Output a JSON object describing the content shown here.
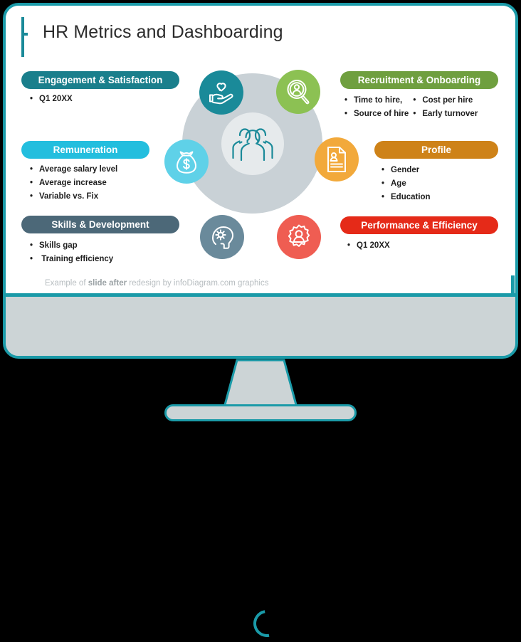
{
  "slide": {
    "title": "HR Metrics and Dashboarding",
    "footer_prefix": "Example of ",
    "footer_bold": "slide after",
    "footer_suffix": " redesign by infoDiagram.com graphics"
  },
  "colors": {
    "teal_dark": "#1a8a99",
    "teal_frame": "#1a9aa8",
    "cyan": "#23bede",
    "cyan_light": "#5fd1e8",
    "green": "#8cc153",
    "green_dark": "#6f9f3f",
    "orange": "#f2a93b",
    "orange_dark": "#ce8218",
    "red": "#e52a18",
    "red_light": "#ef5d52",
    "slate": "#4c6878",
    "slate_light": "#6a8a9b",
    "ring_gray": "#c9d1d6",
    "inner_gray": "#e6eaec",
    "bezel_gray": "#ccd4d6"
  },
  "sections": {
    "engagement": {
      "label": "Engagement & Satisfaction",
      "bullets": [
        "Q1 20XX"
      ]
    },
    "remuneration": {
      "label": "Remuneration",
      "bullets": [
        "Average salary level",
        "Average increase",
        "Variable vs. Fix"
      ]
    },
    "skills": {
      "label": "Skills & Development",
      "bullets": [
        "Skills gap",
        " Training efficiency"
      ]
    },
    "recruitment": {
      "label": "Recruitment & Onboarding",
      "bullets_col1": [
        "Time to hire,",
        "Source of hire"
      ],
      "bullets_col2": [
        "Cost per hire",
        "Early turnover"
      ]
    },
    "profile": {
      "label": "Profile",
      "bullets": [
        "Gender",
        "Age",
        "Education"
      ]
    },
    "performance": {
      "label": "Performance & Efficiency",
      "bullets": [
        "Q1 20XX"
      ]
    }
  },
  "diagram": {
    "center_icon": "three-people-icon",
    "nodes": [
      {
        "icon": "heart-in-hand-icon",
        "color": "#1a8a99"
      },
      {
        "icon": "person-magnifier-icon",
        "color": "#8cc153"
      },
      {
        "icon": "id-document-icon",
        "color": "#f2a93b"
      },
      {
        "icon": "person-gear-icon",
        "color": "#ef5d52"
      },
      {
        "icon": "head-gear-icon",
        "color": "#6a8a9b"
      },
      {
        "icon": "money-bag-icon",
        "color": "#5fd1e8"
      }
    ]
  },
  "monitor": {
    "status_icon": "loading-spinner-icon"
  }
}
